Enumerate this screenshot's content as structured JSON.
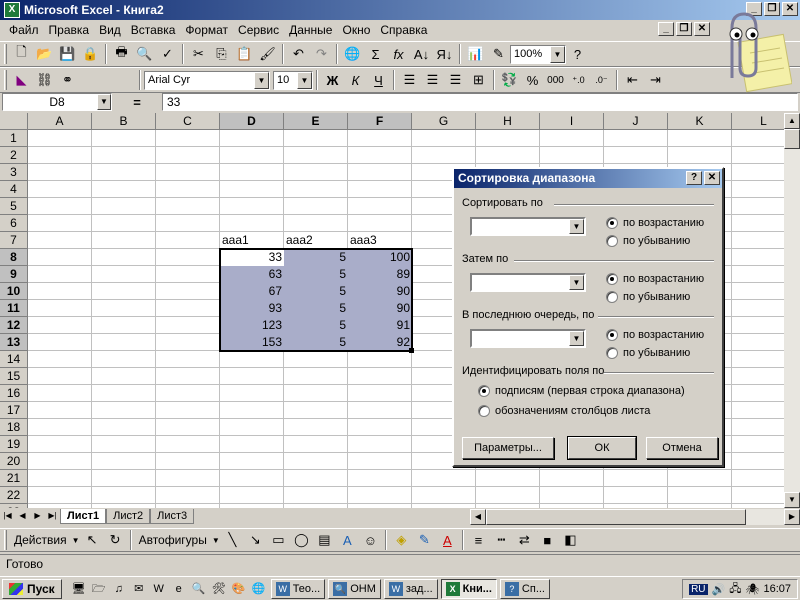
{
  "window": {
    "title": "Microsoft Excel - Книга2",
    "app_icon": "excel-icon"
  },
  "menu": [
    "Файл",
    "Правка",
    "Вид",
    "Вставка",
    "Формат",
    "Сервис",
    "Данные",
    "Окно",
    "Справка"
  ],
  "toolbar_standard": {
    "zoom": "100%"
  },
  "toolbar_format": {
    "font": "Arial Cyr",
    "size": "10",
    "bold": "Ж",
    "italic": "К",
    "underline": "Ч",
    "percent": "%",
    "thousands": "000"
  },
  "formula_bar": {
    "name_box": "D8",
    "eq": "=",
    "value": "33"
  },
  "grid": {
    "columns": [
      "A",
      "B",
      "C",
      "D",
      "E",
      "F",
      "G",
      "H",
      "I",
      "J",
      "K",
      "L"
    ],
    "rows": [
      "1",
      "2",
      "3",
      "4",
      "5",
      "6",
      "7",
      "8",
      "9",
      "10",
      "11",
      "12",
      "13",
      "14",
      "15",
      "16",
      "17",
      "18",
      "19",
      "20",
      "21",
      "22",
      "23"
    ],
    "headers": [
      "aaa1",
      "aaa2",
      "aaa3"
    ],
    "data": [
      [
        "33",
        "5",
        "100"
      ],
      [
        "63",
        "5",
        "89"
      ],
      [
        "67",
        "5",
        "90"
      ],
      [
        "93",
        "5",
        "90"
      ],
      [
        "123",
        "5",
        "91"
      ],
      [
        "153",
        "5",
        "92"
      ]
    ]
  },
  "sheets": [
    "Лист1",
    "Лист2",
    "Лист3"
  ],
  "drawing": {
    "actions": "Действия",
    "autoshapes": "Автофигуры"
  },
  "status": "Готово",
  "dialog": {
    "title": "Сортировка диапазона",
    "sort_by": "Сортировать по",
    "then_by": "Затем по",
    "last_by": "В последнюю очередь, по",
    "asc": "по возрастанию",
    "desc": "по убыванию",
    "identify": "Идентифицировать поля по",
    "opt_labels": "подписям (первая строка диапазона)",
    "opt_columns": "обозначениям столбцов листа",
    "btn_params": "Параметры...",
    "btn_ok": "ОК",
    "btn_cancel": "Отмена"
  },
  "taskbar": {
    "start": "Пуск",
    "tasks": [
      "Тео...",
      "ОНМ",
      "зад...",
      "Кни...",
      "Сп..."
    ],
    "lang": "RU",
    "clock": "16:07"
  }
}
